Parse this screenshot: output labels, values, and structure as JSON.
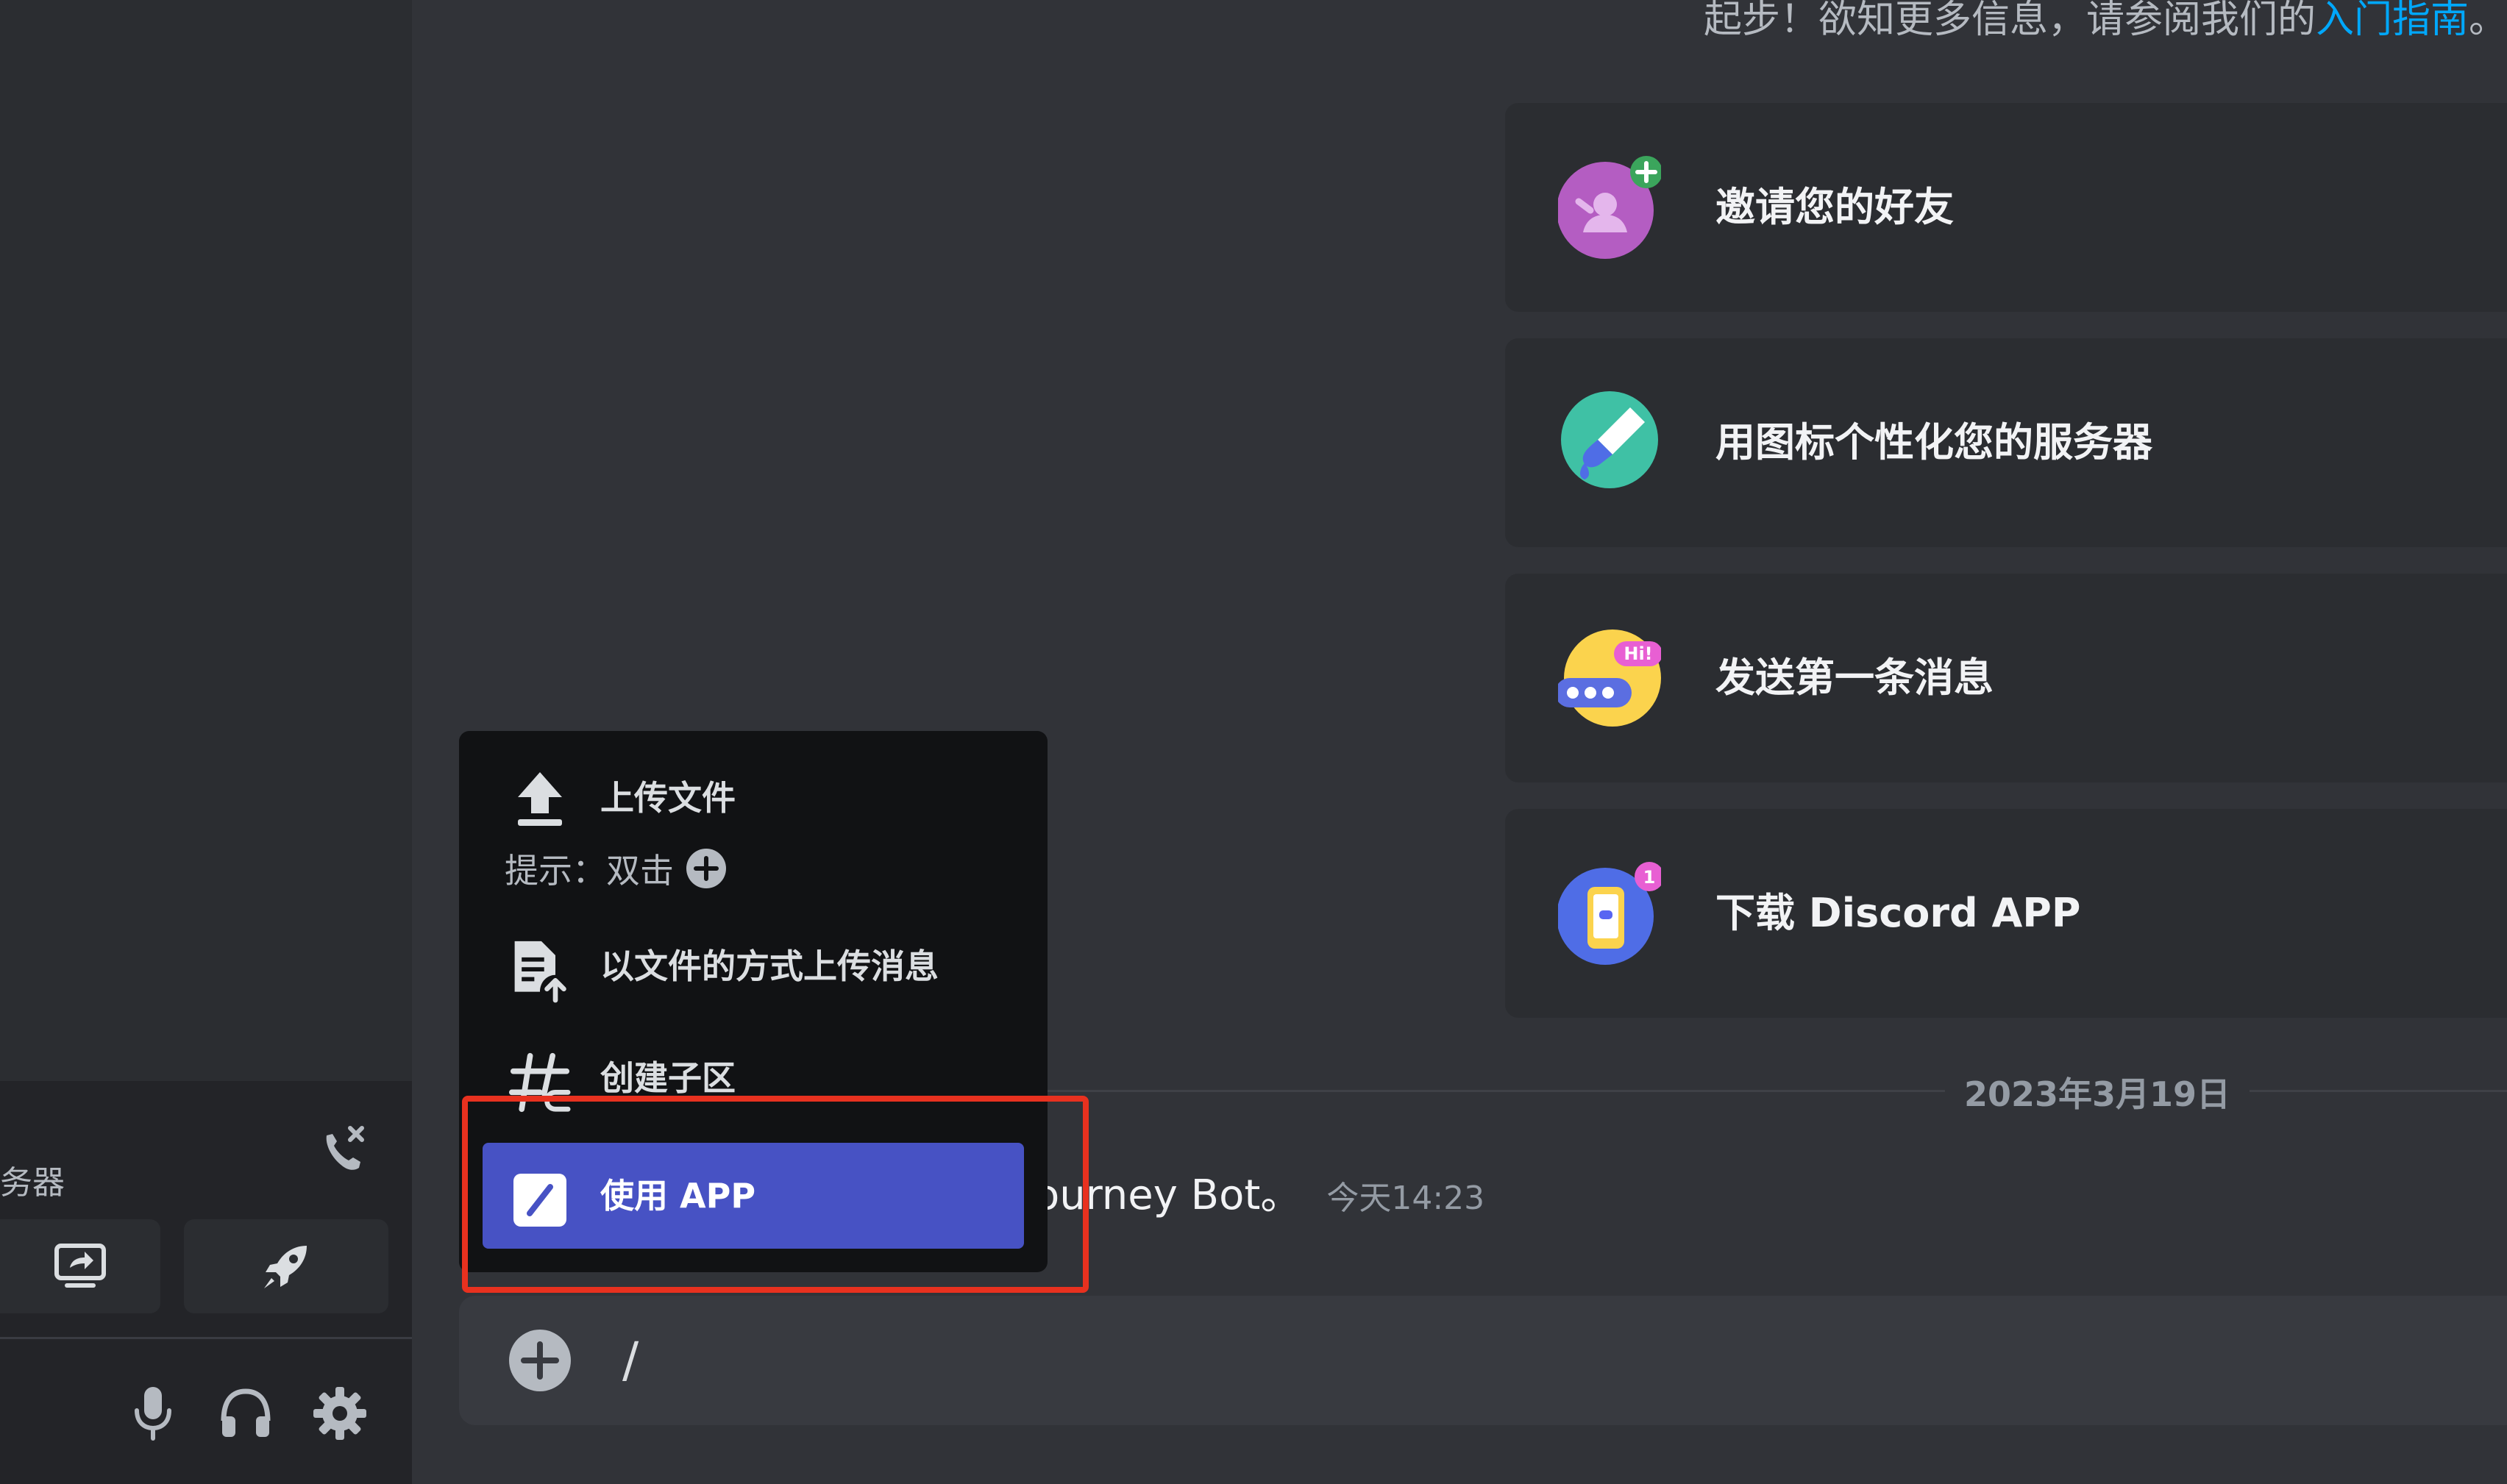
{
  "colors": {
    "background": "#313338",
    "sidebar": "#2b2d31",
    "panel": "#232428",
    "card": "#2b2d31",
    "menu": "#111214",
    "menu_selected": "#4752c4",
    "link": "#00a8fc",
    "highlight": "#e8311f"
  },
  "sidebar": {
    "voice_server_name": "务器",
    "disconnect_icon": "phone-disconnect-icon",
    "screen_share_icon": "screen-share-icon",
    "activity_icon": "rocket-icon",
    "user_controls": [
      "microphone-icon",
      "headphones-icon",
      "gear-icon"
    ]
  },
  "welcome": {
    "text": "起步！欲知更多信息，请参阅我们的",
    "link": "入门指南",
    "suffix": "。"
  },
  "tasks": [
    {
      "label": "邀请您的好友",
      "icon": "invite-friends-icon"
    },
    {
      "label": "用图标个性化您的服务器",
      "icon": "paint-brush-icon"
    },
    {
      "label": "发送第一条消息",
      "icon": "hi-message-icon",
      "badge": "Hi!"
    },
    {
      "label": "下载 Discord APP",
      "icon": "mobile-app-icon",
      "badge": "1"
    }
  ],
  "divider": {
    "date": "2023年3月19日"
  },
  "system_message": {
    "text": "ourney Bot。",
    "time": "今天14:23"
  },
  "menu": {
    "upload_file": "上传文件",
    "upload_hint": "提示：双击",
    "upload_as_message": "以文件的方式上传消息",
    "create_thread": "创建子区",
    "use_app": "使用 APP"
  },
  "composer": {
    "value": "/",
    "attach_icon": "plus-circle-icon"
  }
}
